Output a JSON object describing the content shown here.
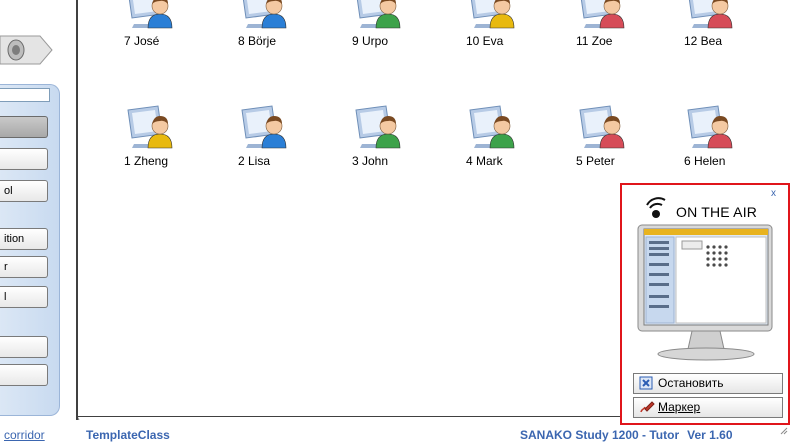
{
  "sidebar": {
    "buttons": [
      {
        "label": "",
        "active": true
      },
      {
        "label": ""
      },
      {
        "label": "ol"
      },
      {
        "label": "ition"
      },
      {
        "label": "r"
      },
      {
        "label": "l"
      },
      {
        "label": ""
      },
      {
        "label": ""
      }
    ],
    "link": "corridor"
  },
  "students_row1": [
    {
      "label": "7 José",
      "color": "#2b7fd6"
    },
    {
      "label": "8 Börje",
      "color": "#2b7fd6"
    },
    {
      "label": "9 Urpo",
      "color": "#3da24a"
    },
    {
      "label": "10 Eva",
      "color": "#e8b90f"
    },
    {
      "label": "11 Zoe",
      "color": "#d64c58"
    },
    {
      "label": "12 Bea",
      "color": "#d64c58"
    }
  ],
  "students_row2": [
    {
      "label": "1 Zheng",
      "color": "#e8b90f"
    },
    {
      "label": "2 Lisa",
      "color": "#2b7fd6"
    },
    {
      "label": "3 John",
      "color": "#3da24a"
    },
    {
      "label": "4 Mark",
      "color": "#3da24a"
    },
    {
      "label": "5 Peter",
      "color": "#d64c58"
    },
    {
      "label": "6 Helen",
      "color": "#d64c58"
    }
  ],
  "on_air": {
    "title": "ON THE AIR",
    "close": "x",
    "stop_label": "Остановить",
    "marker_label": "Маркер",
    "accent_color": "#e0151b"
  },
  "status": {
    "class_name": "TemplateClass",
    "product": "SANAKO Study 1200 - Tutor",
    "version": "Ver 1.60"
  }
}
